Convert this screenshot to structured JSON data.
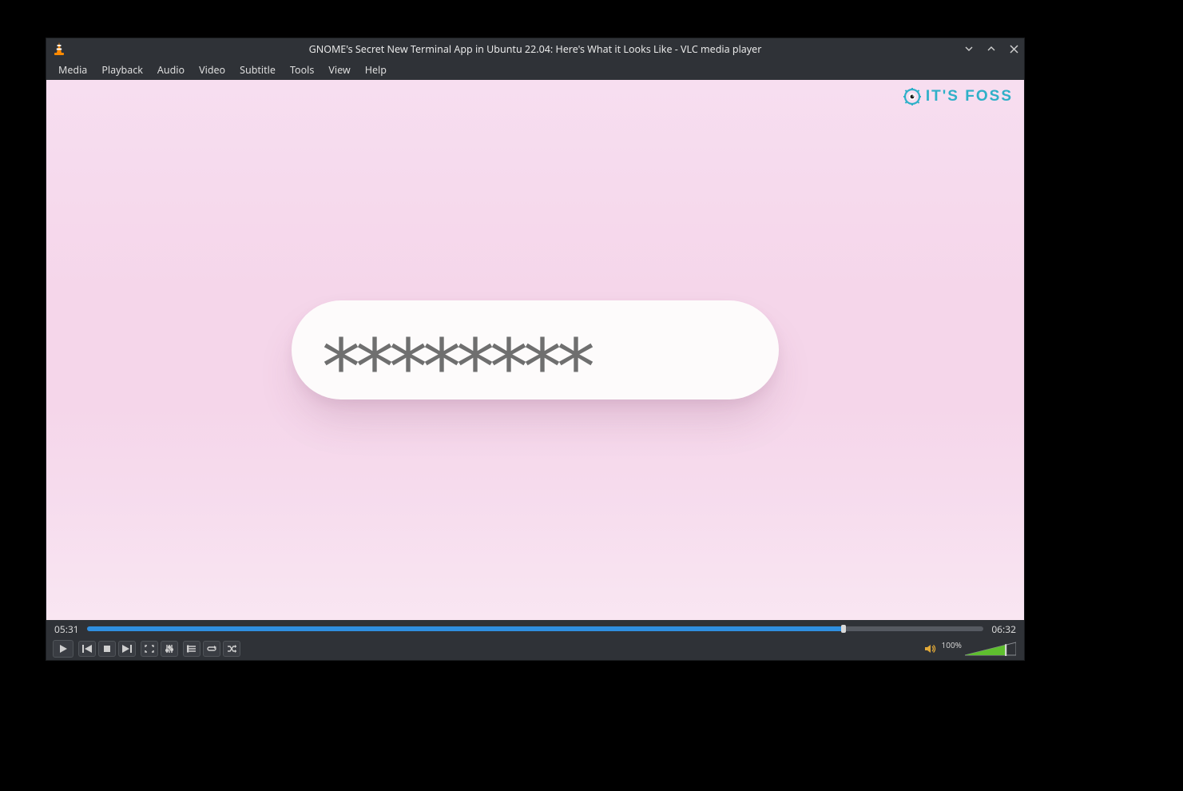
{
  "window": {
    "title": "GNOME's Secret New Terminal App in Ubuntu 22.04: Here's What it Looks Like - VLC media player"
  },
  "menu": {
    "items": [
      "Media",
      "Playback",
      "Audio",
      "Video",
      "Subtitle",
      "Tools",
      "View",
      "Help"
    ]
  },
  "video": {
    "watermark_text": "IT'S FOSS",
    "password_masked": "********"
  },
  "playback": {
    "current_time": "05:31",
    "total_time": "06:32",
    "progress_percent": 84.4
  },
  "volume": {
    "label": "100%",
    "percent": 100
  }
}
